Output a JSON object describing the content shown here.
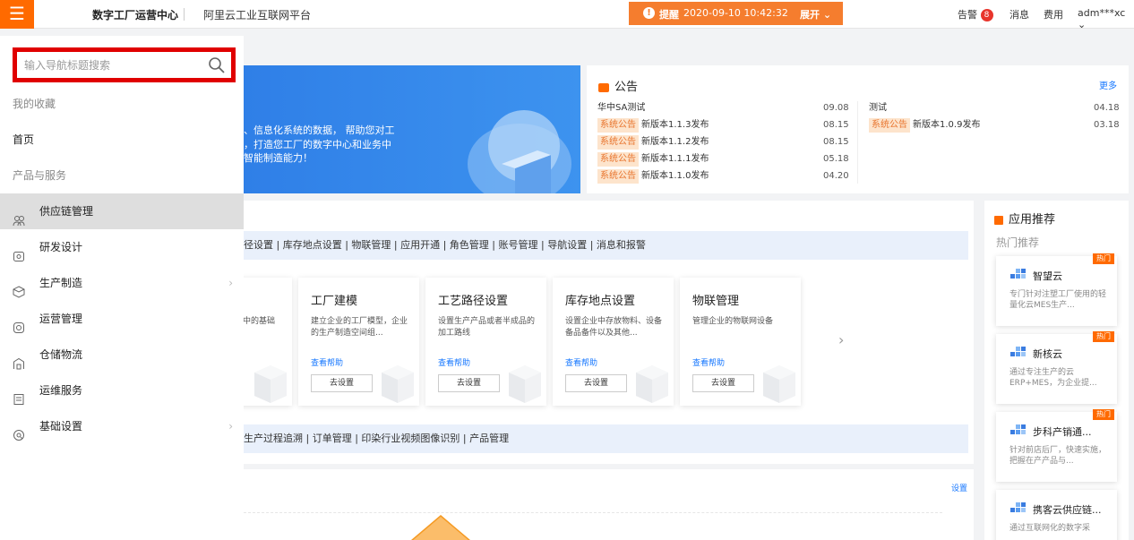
{
  "topbar": {
    "menu_icon": "hamburger-icon",
    "brand": "数字工厂运营中心",
    "platform": "阿里云工业互联网平台",
    "alert": {
      "label": "提醒",
      "time": "2020-09-10 10:42:32",
      "expand": "展开"
    },
    "alarm_label": "告警",
    "alarm_count": "8",
    "message_label": "消息",
    "fee_label": "费用",
    "user": "adm***xc"
  },
  "banner": {
    "line1": "、信息化系统的数据， 帮助您对工",
    "line2": "，打造您工厂的数字中心和业务中",
    "line3": "智能制造能力！"
  },
  "notice": {
    "title": "公告",
    "more": "更多",
    "left": [
      {
        "tag": "",
        "text": "华中SA测试",
        "date": "09.08"
      },
      {
        "tag": "系统公告",
        "text": "新版本1.1.3发布",
        "date": "08.15"
      },
      {
        "tag": "系统公告",
        "text": "新版本1.1.2发布",
        "date": "08.15"
      },
      {
        "tag": "系统公告",
        "text": "新版本1.1.1发布",
        "date": "05.18"
      },
      {
        "tag": "系统公告",
        "text": "新版本1.1.0发布",
        "date": "04.20"
      }
    ],
    "right": [
      {
        "tag": "",
        "text": "测试",
        "date": "04.18"
      },
      {
        "tag": "系统公告",
        "text": "新版本1.0.9发布",
        "date": "03.18"
      }
    ]
  },
  "main": {
    "links_top": "径设置 | 库存地点设置 | 物联管理 | 应用开通 | 角色管理 | 账号管理 | 导航设置 | 消息和报警",
    "links_bottom": "生产过程追溯 | 订单管理 | 印染行业视频图像识别 | 产品管理",
    "cards": [
      {
        "title": "",
        "desc": "中的基础",
        "help": "",
        "button": ""
      },
      {
        "title": "工厂建模",
        "desc": "建立企业的工厂模型，企业的生产制造空间组...",
        "help": "查看帮助",
        "button": "去设置"
      },
      {
        "title": "工艺路径设置",
        "desc": "设置生产产品或者半成品的加工路线",
        "help": "查看帮助",
        "button": "去设置"
      },
      {
        "title": "库存地点设置",
        "desc": "设置企业中存放物料、设备备品备件以及其他...",
        "help": "查看帮助",
        "button": "去设置"
      },
      {
        "title": "物联管理",
        "desc": "管理企业的物联网设备",
        "help": "查看帮助",
        "button": "去设置"
      }
    ],
    "setting_link": "设置"
  },
  "reco": {
    "title": "应用推荐",
    "subtitle": "热门推荐",
    "items": [
      {
        "hot": "热门",
        "name": "智望云",
        "desc": "专门针对注塑工厂使用的轻量化云MES生产..."
      },
      {
        "hot": "热门",
        "name": "新核云",
        "desc": "通过专注生产的云ERP+MES，为企业提..."
      },
      {
        "hot": "热门",
        "name": "步科产销通...",
        "desc": "针对前店后厂，快速实施，把握在产产品与..."
      },
      {
        "hot": "",
        "name": "携客云供应链...",
        "desc": "通过互联网化的数字采"
      }
    ]
  },
  "sidebar": {
    "search_placeholder": "输入导航标题搜索",
    "favorites": "我的收藏",
    "home": "首页",
    "section": "产品与服务",
    "items": [
      {
        "icon": "supply-chain-icon",
        "label": "供应链管理",
        "active": true,
        "chevron": false
      },
      {
        "icon": "rd-design-icon",
        "label": "研发设计",
        "active": false,
        "chevron": false
      },
      {
        "icon": "production-icon",
        "label": "生产制造",
        "active": false,
        "chevron": true
      },
      {
        "icon": "operations-icon",
        "label": "运营管理",
        "active": false,
        "chevron": false
      },
      {
        "icon": "warehouse-icon",
        "label": "仓储物流",
        "active": false,
        "chevron": false
      },
      {
        "icon": "maintenance-icon",
        "label": "运维服务",
        "active": false,
        "chevron": false
      },
      {
        "icon": "basic-settings-icon",
        "label": "基础设置",
        "active": false,
        "chevron": true
      }
    ]
  },
  "colors": {
    "accent": "#ff6a00",
    "alert": "#f57d2e",
    "link": "#1677ff",
    "highlight": "#e00000"
  }
}
